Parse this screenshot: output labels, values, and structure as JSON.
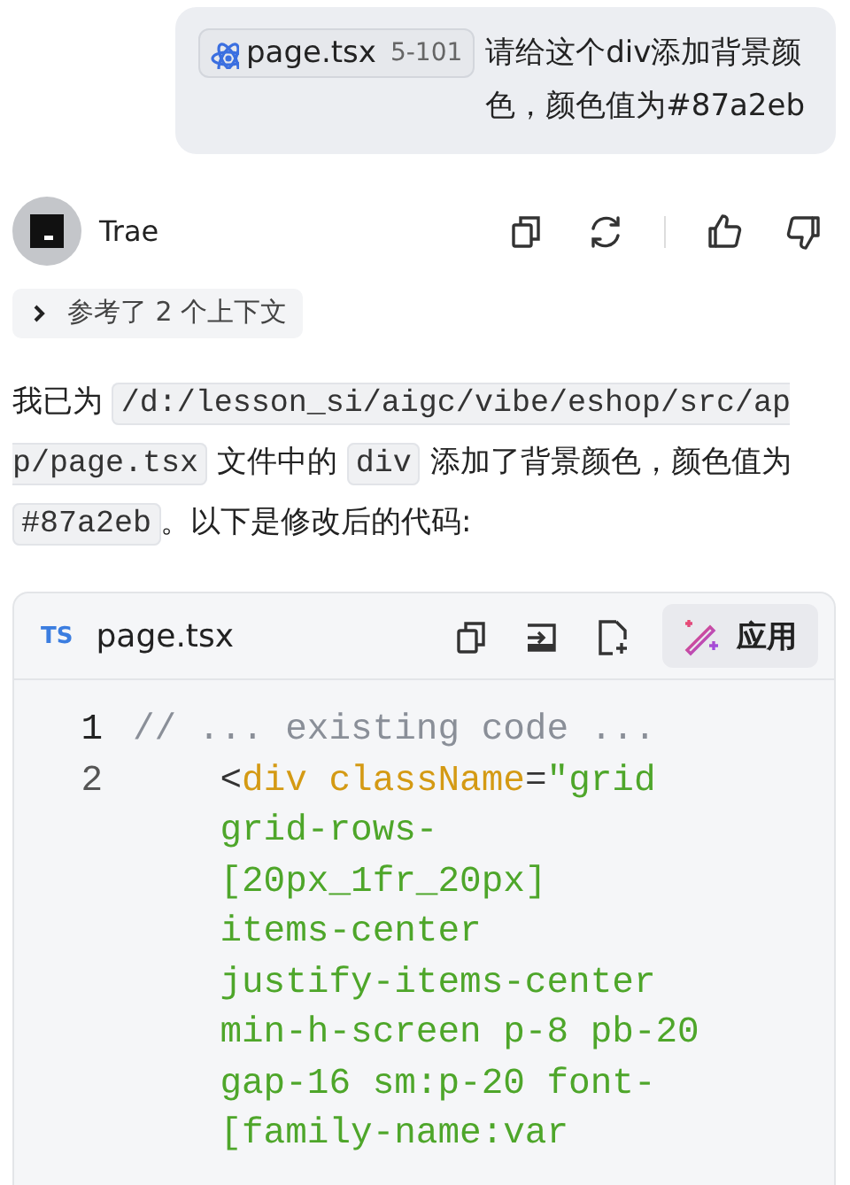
{
  "user_message": {
    "file_chip": {
      "name": "page.tsx",
      "range": "5-101"
    },
    "text": "请给这个div添加背景颜色，颜色值为#87a2eb"
  },
  "assistant": {
    "name": "Trae",
    "context": {
      "label": "参考了 2 个上下文",
      "expanded": false
    },
    "paragraph": [
      {
        "kind": "text",
        "text": "我已为 "
      },
      {
        "kind": "code",
        "text": "/d:/lesson_si/aigc/vibe/eshop/src/app/page.tsx"
      },
      {
        "kind": "text",
        "text": " 文件中的 "
      },
      {
        "kind": "code",
        "text": "div"
      },
      {
        "kind": "text",
        "text": " 添加了背景颜色，颜色值为 "
      },
      {
        "kind": "code",
        "text": "#87a2eb"
      },
      {
        "kind": "text",
        "text": "。以下是修改后的代码:"
      }
    ],
    "code_block": {
      "language": "TS",
      "filename": "page.tsx",
      "apply_label": "应用",
      "lines": [
        {
          "number": "1",
          "rows": [
            [
              {
                "kind": "comment",
                "text": "// ... existing code ..."
              }
            ]
          ]
        },
        {
          "number": "2",
          "rows": [
            [
              {
                "kind": "punct",
                "text": "<"
              },
              {
                "kind": "tag",
                "text": "div"
              },
              {
                "kind": "punct",
                "text": " "
              },
              {
                "kind": "attr",
                "text": "className"
              },
              {
                "kind": "punct",
                "text": "="
              },
              {
                "kind": "string",
                "text": "\"grid"
              }
            ],
            [
              {
                "kind": "string",
                "text": "grid-rows-"
              }
            ],
            [
              {
                "kind": "string",
                "text": "[20px_1fr_20px]"
              }
            ],
            [
              {
                "kind": "string",
                "text": "items-center"
              }
            ],
            [
              {
                "kind": "string",
                "text": "justify-items-center"
              }
            ],
            [
              {
                "kind": "string",
                "text": "min-h-screen p-8 pb-20"
              }
            ],
            [
              {
                "kind": "string",
                "text": "gap-16 sm:p-20 font-"
              }
            ],
            [
              {
                "kind": "string",
                "text": "[family-name:var"
              }
            ]
          ]
        }
      ]
    }
  }
}
